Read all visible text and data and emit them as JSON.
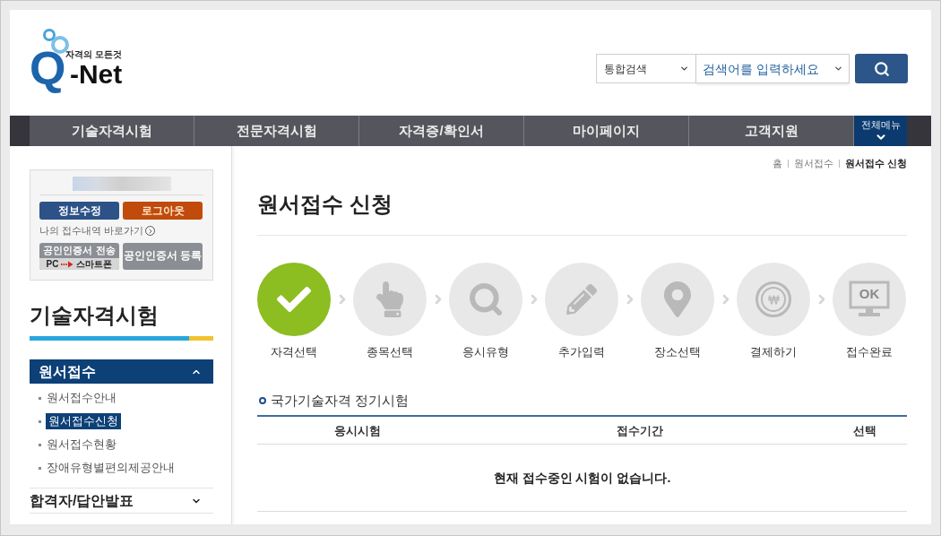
{
  "logo": {
    "letter": "Q",
    "name": "-Net",
    "tagline": "자격의 모든것"
  },
  "search": {
    "scope": "통합검색",
    "placeholder": "검색어를 입력하세요"
  },
  "nav": {
    "items": [
      {
        "label": "기술자격시험"
      },
      {
        "label": "전문자격시험"
      },
      {
        "label": "자격증/확인서"
      },
      {
        "label": "마이페이지"
      },
      {
        "label": "고객지원"
      }
    ],
    "all_menu": "전체메뉴"
  },
  "user_box": {
    "buttons": [
      {
        "label": "정보수정",
        "kind": "primary"
      },
      {
        "label": "로그아웃",
        "kind": "danger"
      }
    ],
    "history_link": "나의 접수내역 바로가기",
    "cert_buttons": [
      {
        "kind": "transfer",
        "label": "공인인증서 전송",
        "from": "PC",
        "to": "스마트폰"
      },
      {
        "kind": "register",
        "label": "공인인증서 등록"
      }
    ]
  },
  "sidebar": {
    "title": "기술자격시험",
    "menu": [
      {
        "label": "원서접수",
        "expanded": true,
        "children": [
          {
            "label": "원서접수안내",
            "selected": false
          },
          {
            "label": "원서접수신청",
            "selected": true
          },
          {
            "label": "원서접수현황",
            "selected": false
          },
          {
            "label": "장애유형별편의제공안내",
            "selected": false
          }
        ]
      },
      {
        "label": "합격자/답안발표",
        "expanded": false
      }
    ]
  },
  "breadcrumb": [
    {
      "label": "홈",
      "current": false
    },
    {
      "label": "원서접수",
      "current": false
    },
    {
      "label": "원서접수 신청",
      "current": true
    }
  ],
  "page_title": "원서접수 신청",
  "steps": [
    {
      "label": "자격선택",
      "active": true
    },
    {
      "label": "종목선택",
      "active": false
    },
    {
      "label": "응시유형",
      "active": false
    },
    {
      "label": "추가입력",
      "active": false
    },
    {
      "label": "장소선택",
      "active": false
    },
    {
      "label": "결제하기",
      "active": false
    },
    {
      "label": "접수완료",
      "active": false,
      "screen_text": "OK"
    }
  ],
  "section": {
    "title": "국가기술자격 정기시험",
    "table": {
      "columns": [
        "응시시험",
        "접수기간",
        "선택"
      ],
      "empty_message": "현재 접수중인 시험이 없습니다."
    }
  }
}
